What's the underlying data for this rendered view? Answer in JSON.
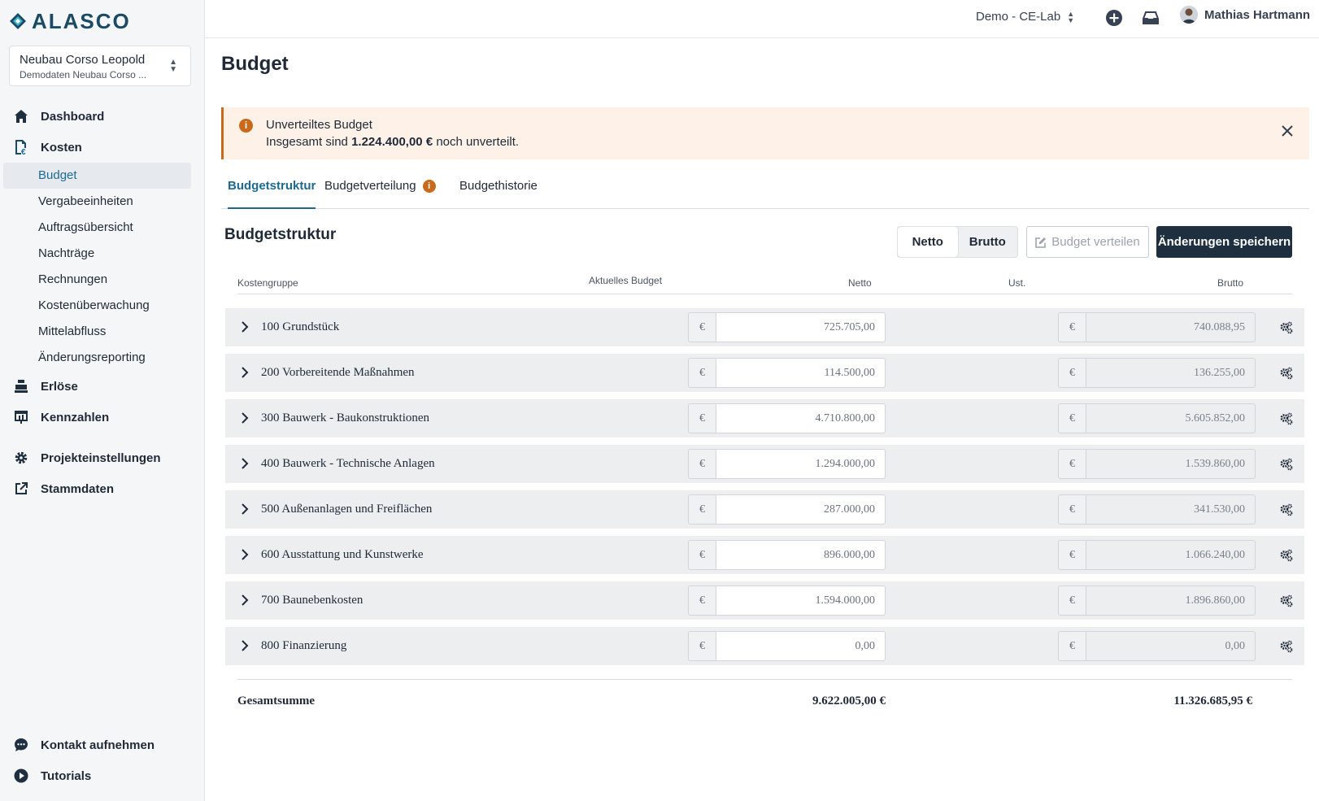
{
  "app": {
    "logo": "ALASCO"
  },
  "project": {
    "title": "Neubau Corso Leopold",
    "subtitle": "Demodaten Neubau Corso ..."
  },
  "nav": {
    "dashboard": "Dashboard",
    "kosten": "Kosten",
    "sub": [
      "Budget",
      "Vergabeeinheiten",
      "Auftragsübersicht",
      "Nachträge",
      "Rechnungen",
      "Kostenüberwachung",
      "Mittelabfluss",
      "Änderungsreporting"
    ],
    "erloese": "Erlöse",
    "kennzahlen": "Kennzahlen",
    "projekteinstellungen": "Projekteinstellungen",
    "stammdaten": "Stammdaten",
    "kontakt": "Kontakt aufnehmen",
    "tutorials": "Tutorials"
  },
  "topbar": {
    "tenant": "Demo - CE-Lab",
    "user": "Mathias Hartmann"
  },
  "page": {
    "title": "Budget"
  },
  "alert": {
    "title": "Unverteiltes Budget",
    "text_pre": "Insgesamt sind ",
    "amount": "1.224.400,00 €",
    "text_post": " noch unverteilt."
  },
  "tabs": [
    "Budgetstruktur",
    "Budgetverteilung",
    "Budgethistorie"
  ],
  "section": {
    "title": "Budgetstruktur",
    "toggle": [
      "Netto",
      "Brutto"
    ],
    "distribute": "Budget verteilen",
    "save": "Änderungen speichern"
  },
  "table": {
    "headers": {
      "kostengruppe": "Kostengruppe",
      "aktuell": "Aktuelles Budget",
      "netto": "Netto",
      "ust": "Ust.",
      "brutto": "Brutto"
    },
    "currency": "€",
    "rows": [
      {
        "name": "100 Grundstück",
        "netto": "725.705,00",
        "brutto": "740.088,95"
      },
      {
        "name": "200 Vorbereitende Maßnahmen",
        "netto": "114.500,00",
        "brutto": "136.255,00"
      },
      {
        "name": "300 Bauwerk - Baukonstruktionen",
        "netto": "4.710.800,00",
        "brutto": "5.605.852,00"
      },
      {
        "name": "400 Bauwerk - Technische Anlagen",
        "netto": "1.294.000,00",
        "brutto": "1.539.860,00"
      },
      {
        "name": "500 Außenanlagen und Freiflächen",
        "netto": "287.000,00",
        "brutto": "341.530,00"
      },
      {
        "name": "600 Ausstattung und Kunstwerke",
        "netto": "896.000,00",
        "brutto": "1.066.240,00"
      },
      {
        "name": "700 Baunebenkosten",
        "netto": "1.594.000,00",
        "brutto": "1.896.860,00"
      },
      {
        "name": "800 Finanzierung",
        "netto": "0,00",
        "brutto": "0,00"
      }
    ],
    "total": {
      "label": "Gesamtsumme",
      "netto": "9.622.005,00 €",
      "brutto": "11.326.685,95 €"
    }
  },
  "colors": {
    "brand": "#1b4b64",
    "accent": "#1b6a92",
    "warning": "#c96a1b",
    "dark_button": "#1e2f40"
  }
}
